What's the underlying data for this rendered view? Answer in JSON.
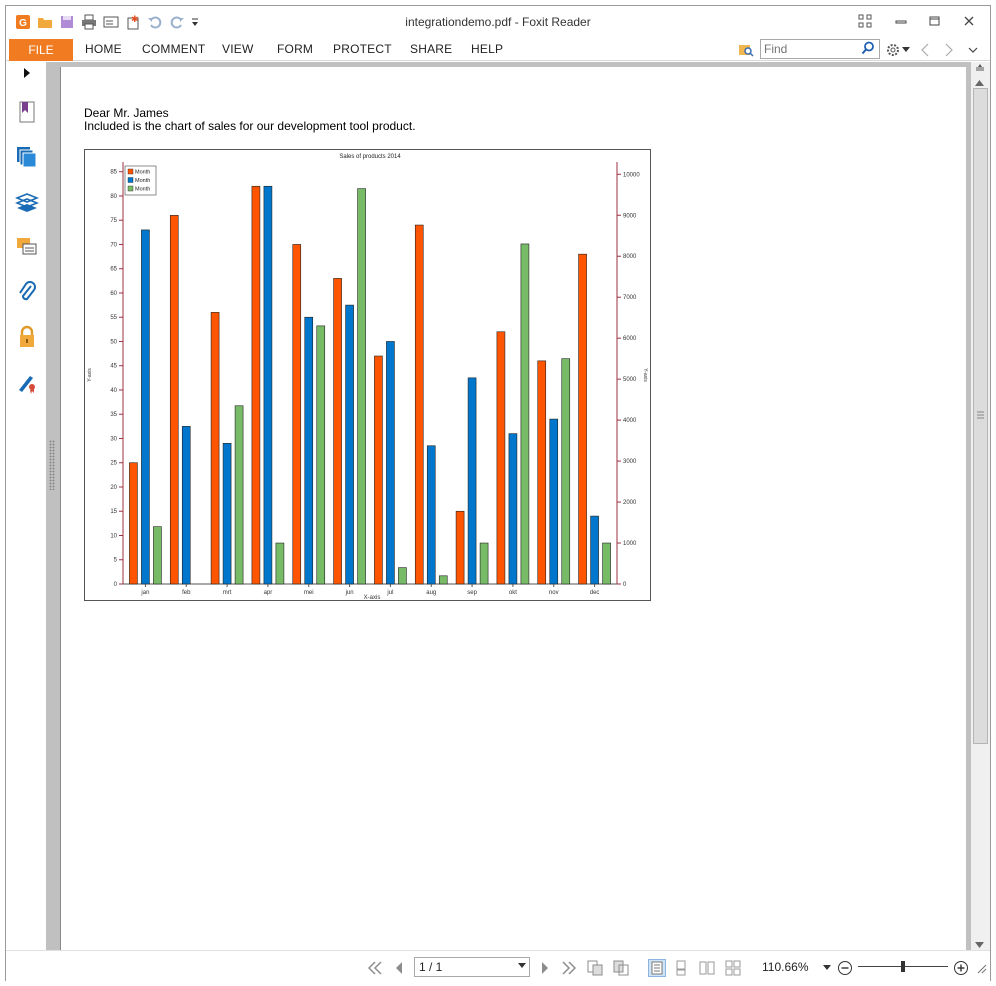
{
  "window": {
    "title": "integrationdemo.pdf - Foxit Reader"
  },
  "menu": {
    "file": "FILE",
    "items": [
      "HOME",
      "COMMENT",
      "VIEW",
      "FORM",
      "PROTECT",
      "SHARE",
      "HELP"
    ]
  },
  "search": {
    "placeholder": "Find",
    "value": ""
  },
  "navpanel": {
    "icons": [
      "expand-arrow-icon",
      "bookmark-icon",
      "pages-icon",
      "layers-icon",
      "comments-icon",
      "attachment-icon",
      "security-icon",
      "signature-icon"
    ]
  },
  "document": {
    "salutation": "Dear Mr. James",
    "body": "Included is the chart of sales for our development tool product."
  },
  "chart_data": {
    "type": "bar",
    "title": "Sales of products 2014",
    "xlabel": "X-axis",
    "ylabel": "Y-axis",
    "y2label": "Y-axis",
    "categories": [
      "jan",
      "feb",
      "mrt",
      "apr",
      "mei",
      "jun",
      "jul",
      "aug",
      "sep",
      "okt",
      "nov",
      "dec"
    ],
    "ylim": [
      0,
      87
    ],
    "yticks": [
      0,
      5,
      10,
      15,
      20,
      25,
      30,
      35,
      40,
      45,
      50,
      55,
      60,
      65,
      70,
      75,
      80,
      85
    ],
    "y2lim": [
      0,
      10300
    ],
    "y2ticks": [
      0,
      1000,
      2000,
      3000,
      4000,
      5000,
      6000,
      7000,
      8000,
      9000,
      10000
    ],
    "legend_position": "top-left",
    "series": [
      {
        "name": "Month",
        "color": "#ff5500",
        "axis": "left",
        "values": [
          25,
          76,
          56,
          82,
          70,
          63,
          47,
          74,
          15,
          52,
          46,
          68
        ]
      },
      {
        "name": "Month",
        "color": "#0077cc",
        "axis": "left",
        "values": [
          73,
          32.5,
          29,
          82,
          55,
          57.5,
          50,
          28.5,
          42.5,
          31,
          34,
          14
        ]
      },
      {
        "name": "Month",
        "color": "#77bb66",
        "axis": "right",
        "values": [
          1400,
          0,
          4350,
          1000,
          6300,
          9650,
          400,
          200,
          1000,
          8300,
          5500,
          1000
        ]
      }
    ]
  },
  "statusbar": {
    "page": "1 / 1",
    "zoom": "110.66%"
  },
  "colors": {
    "accent": "#f07b21",
    "panel": "#c0c0c0"
  }
}
